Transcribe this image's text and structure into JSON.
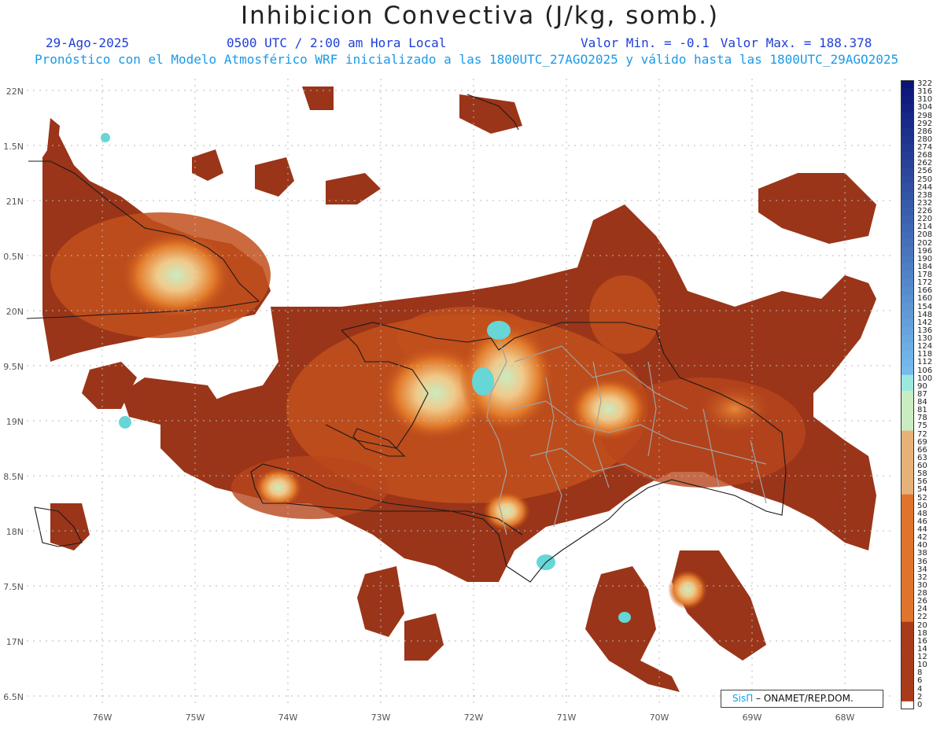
{
  "title": "Inhibicion Convectiva (J/kg, somb.)",
  "header": {
    "date": "29-Ago-2025",
    "time": "0500 UTC / 2:00 am Hora Local",
    "min": "Valor Min. = -0.1",
    "max": "Valor Max. = 188.378",
    "model": "Pronóstico con el Modelo Atmosférico WRF inicializado a las 1800UTC_27AGO2025 y válido hasta las  1800UTC_29AGO2025"
  },
  "map": {
    "lat_labels": [
      "22N",
      "1.5N",
      "21N",
      "0.5N",
      "20N",
      "9.5N",
      "19N",
      "8.5N",
      "18N",
      "7.5N",
      "17N",
      "6.5N"
    ],
    "lon_labels": [
      "76W",
      "75W",
      "74W",
      "73W",
      "72W",
      "71W",
      "70W",
      "69W",
      "68W"
    ],
    "colors": {
      "dark": "#9a3519",
      "mid": "#c2501c",
      "orange": "#e27a2a",
      "light": "#f0c98a",
      "pale": "#c9ecc0",
      "cyan": "#66d6d6",
      "outline": "#1a1a1a",
      "provinces": "#a0a0a0"
    }
  },
  "colorbar": {
    "labels": [
      "322",
      "316",
      "310",
      "304",
      "298",
      "292",
      "286",
      "280",
      "274",
      "268",
      "262",
      "256",
      "250",
      "244",
      "238",
      "232",
      "226",
      "220",
      "214",
      "208",
      "202",
      "196",
      "190",
      "184",
      "178",
      "172",
      "166",
      "160",
      "154",
      "148",
      "142",
      "136",
      "130",
      "124",
      "118",
      "112",
      "106",
      "100",
      "90",
      "87",
      "84",
      "81",
      "78",
      "75",
      "72",
      "69",
      "66",
      "63",
      "60",
      "58",
      "56",
      "54",
      "52",
      "50",
      "48",
      "46",
      "44",
      "42",
      "40",
      "38",
      "36",
      "34",
      "32",
      "30",
      "28",
      "26",
      "24",
      "22",
      "20",
      "18",
      "16",
      "14",
      "12",
      "10",
      "8",
      "6",
      "4",
      "2",
      "0"
    ]
  },
  "credit": {
    "sis": "SisΠ",
    "text": " – ONAMET/REP.DOM."
  }
}
